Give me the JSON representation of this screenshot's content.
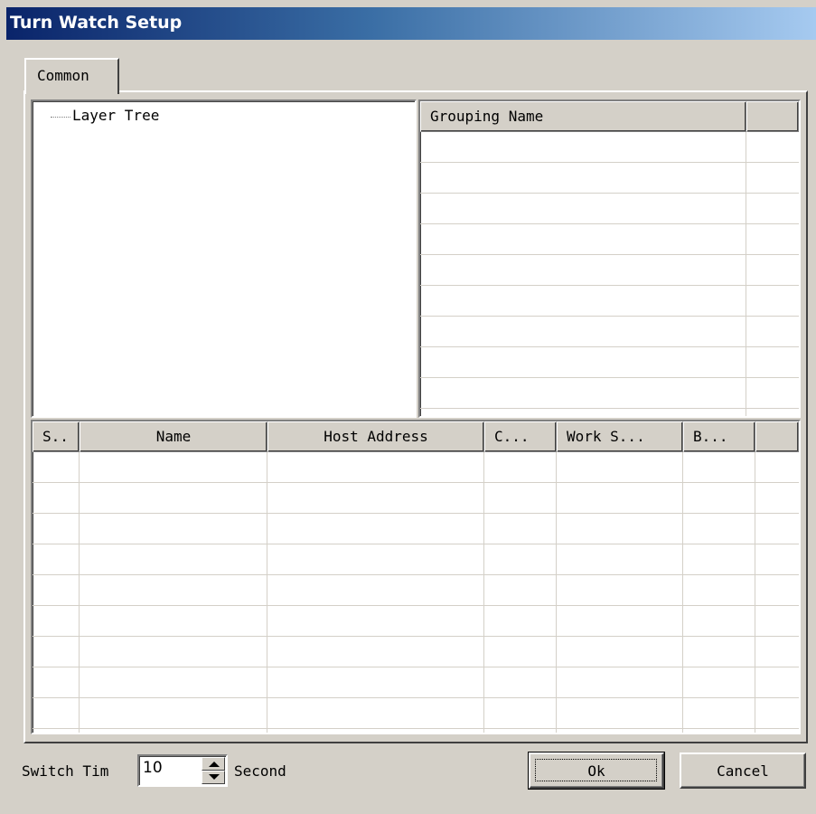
{
  "window": {
    "title": "Turn Watch Setup"
  },
  "tabs": [
    {
      "label": "Common"
    }
  ],
  "tree": {
    "root_label": "Layer Tree"
  },
  "grouping": {
    "columns": [
      {
        "label": "Grouping Name"
      },
      {
        "label": ""
      }
    ]
  },
  "hosts": {
    "columns": [
      {
        "label": "S.."
      },
      {
        "label": "Name"
      },
      {
        "label": "Host Address"
      },
      {
        "label": "C..."
      },
      {
        "label": "Work S..."
      },
      {
        "label": "B..."
      },
      {
        "label": ""
      }
    ]
  },
  "footer": {
    "switch_label": "Switch Tim",
    "switch_value": "10",
    "unit_label": "Second",
    "ok_label": "Ok",
    "cancel_label": "Cancel"
  }
}
